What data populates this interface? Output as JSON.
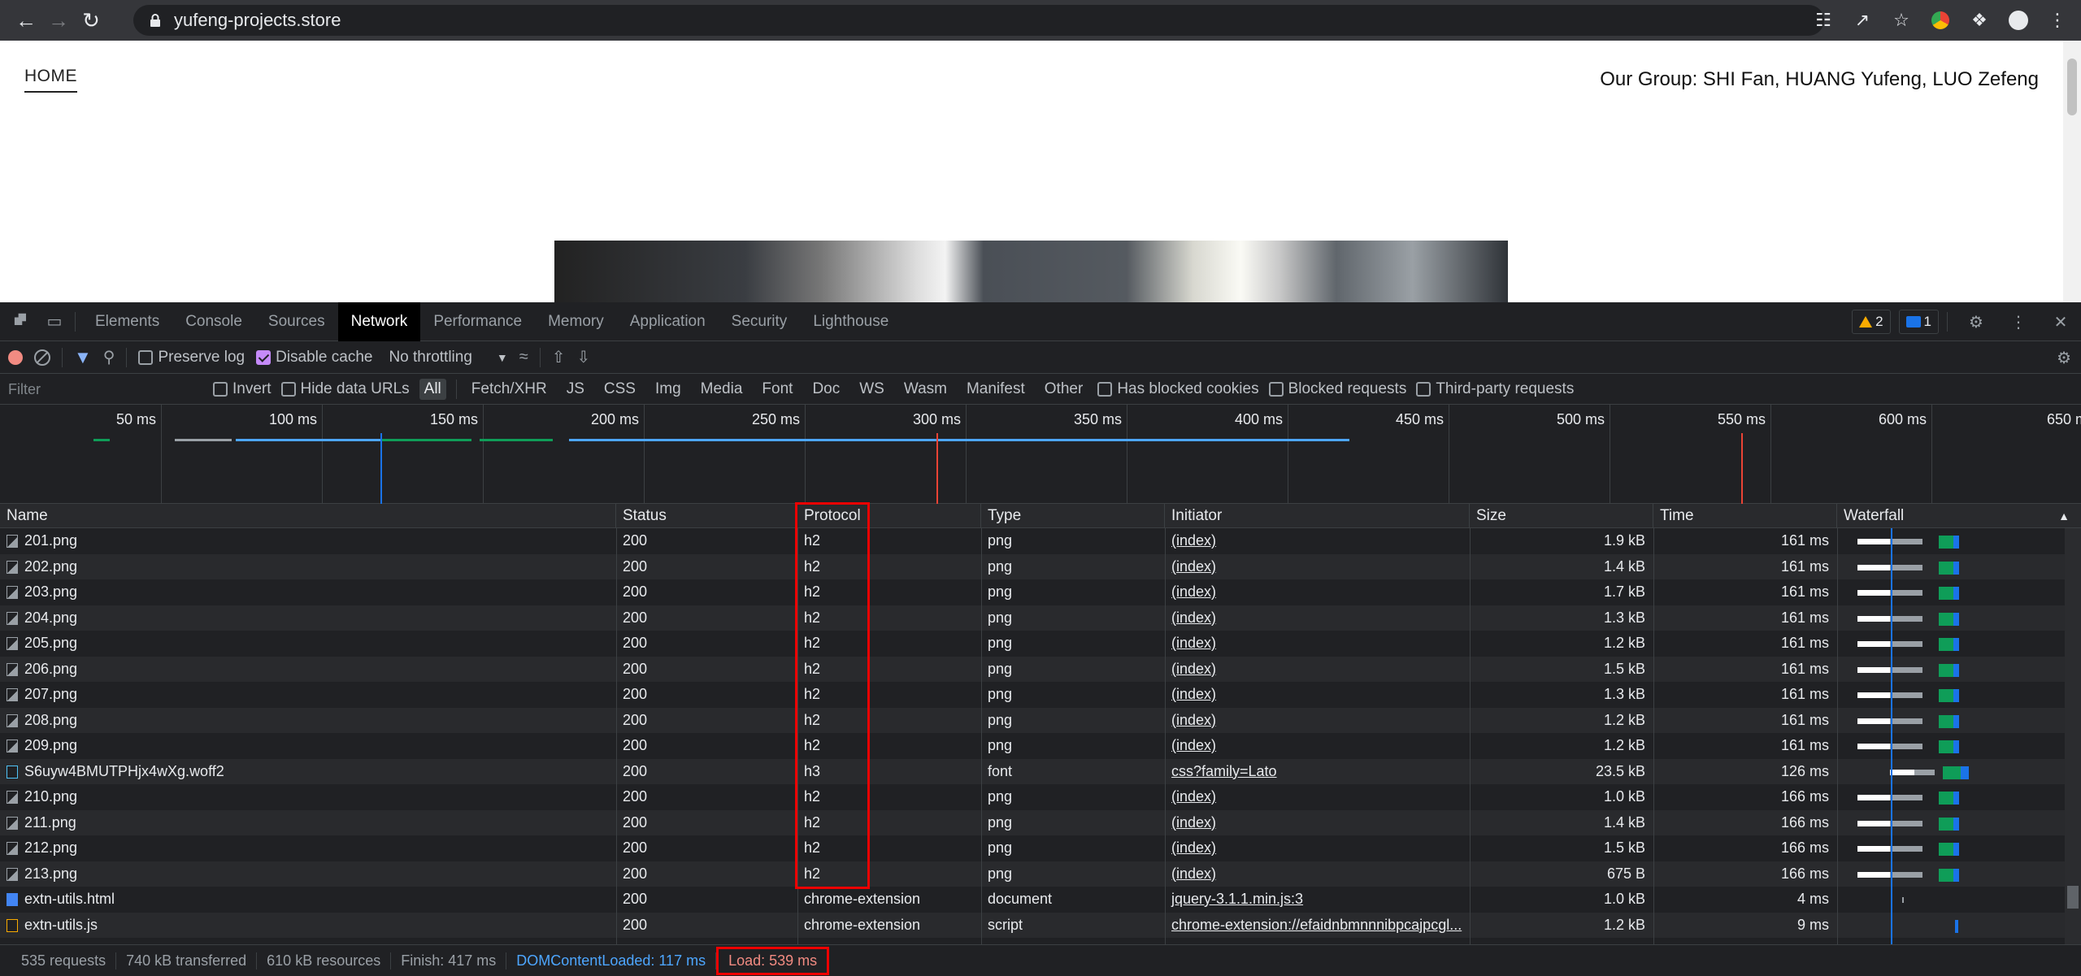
{
  "browser": {
    "url": "yufeng-projects.store",
    "icons": [
      "back-icon",
      "forward-icon",
      "reload-icon",
      "translate-icon",
      "share-icon",
      "star-icon",
      "chrome-ext-icon",
      "extensions-icon",
      "profile-icon",
      "menu-icon"
    ]
  },
  "page": {
    "nav_home": "HOME",
    "group_text": "Our Group: SHI Fan, HUANG Yufeng, LUO Zefeng"
  },
  "devtools": {
    "tabs": [
      "Elements",
      "Console",
      "Sources",
      "Network",
      "Performance",
      "Memory",
      "Application",
      "Security",
      "Lighthouse"
    ],
    "active_tab": "Network",
    "warnings": "2",
    "messages": "1",
    "toolbar": {
      "preserve_log": "Preserve log",
      "disable_cache": "Disable cache",
      "throttling": "No throttling"
    },
    "filter": {
      "placeholder": "Filter",
      "invert": "Invert",
      "hide_data_urls": "Hide data URLs",
      "types": [
        "All",
        "Fetch/XHR",
        "JS",
        "CSS",
        "Img",
        "Media",
        "Font",
        "Doc",
        "WS",
        "Wasm",
        "Manifest",
        "Other"
      ],
      "has_blocked_cookies": "Has blocked cookies",
      "blocked_requests": "Blocked requests",
      "third_party": "Third-party requests"
    },
    "overview_ticks": [
      "50 ms",
      "100 ms",
      "150 ms",
      "200 ms",
      "250 ms",
      "300 ms",
      "350 ms",
      "400 ms",
      "450 ms",
      "500 ms",
      "550 ms",
      "600 ms",
      "650 m"
    ],
    "columns": [
      "Name",
      "Status",
      "Protocol",
      "Type",
      "Initiator",
      "Size",
      "Time",
      "Waterfall"
    ],
    "rows": [
      {
        "name": "201.png",
        "status": "200",
        "protocol": "h2",
        "type": "png",
        "initiator": "(index)",
        "size": "1.9 kB",
        "time": "161 ms",
        "icon": "img"
      },
      {
        "name": "202.png",
        "status": "200",
        "protocol": "h2",
        "type": "png",
        "initiator": "(index)",
        "size": "1.4 kB",
        "time": "161 ms",
        "icon": "img"
      },
      {
        "name": "203.png",
        "status": "200",
        "protocol": "h2",
        "type": "png",
        "initiator": "(index)",
        "size": "1.7 kB",
        "time": "161 ms",
        "icon": "img"
      },
      {
        "name": "204.png",
        "status": "200",
        "protocol": "h2",
        "type": "png",
        "initiator": "(index)",
        "size": "1.3 kB",
        "time": "161 ms",
        "icon": "img"
      },
      {
        "name": "205.png",
        "status": "200",
        "protocol": "h2",
        "type": "png",
        "initiator": "(index)",
        "size": "1.2 kB",
        "time": "161 ms",
        "icon": "img"
      },
      {
        "name": "206.png",
        "status": "200",
        "protocol": "h2",
        "type": "png",
        "initiator": "(index)",
        "size": "1.5 kB",
        "time": "161 ms",
        "icon": "img"
      },
      {
        "name": "207.png",
        "status": "200",
        "protocol": "h2",
        "type": "png",
        "initiator": "(index)",
        "size": "1.3 kB",
        "time": "161 ms",
        "icon": "img"
      },
      {
        "name": "208.png",
        "status": "200",
        "protocol": "h2",
        "type": "png",
        "initiator": "(index)",
        "size": "1.2 kB",
        "time": "161 ms",
        "icon": "img"
      },
      {
        "name": "209.png",
        "status": "200",
        "protocol": "h2",
        "type": "png",
        "initiator": "(index)",
        "size": "1.2 kB",
        "time": "161 ms",
        "icon": "img"
      },
      {
        "name": "S6uyw4BMUTPHjx4wXg.woff2",
        "status": "200",
        "protocol": "h3",
        "type": "font",
        "initiator": "css?family=Lato",
        "size": "23.5 kB",
        "time": "126 ms",
        "icon": "font"
      },
      {
        "name": "210.png",
        "status": "200",
        "protocol": "h2",
        "type": "png",
        "initiator": "(index)",
        "size": "1.0 kB",
        "time": "166 ms",
        "icon": "img"
      },
      {
        "name": "211.png",
        "status": "200",
        "protocol": "h2",
        "type": "png",
        "initiator": "(index)",
        "size": "1.4 kB",
        "time": "166 ms",
        "icon": "img"
      },
      {
        "name": "212.png",
        "status": "200",
        "protocol": "h2",
        "type": "png",
        "initiator": "(index)",
        "size": "1.5 kB",
        "time": "166 ms",
        "icon": "img"
      },
      {
        "name": "213.png",
        "status": "200",
        "protocol": "h2",
        "type": "png",
        "initiator": "(index)",
        "size": "675 B",
        "time": "166 ms",
        "icon": "img"
      },
      {
        "name": "extn-utils.html",
        "status": "200",
        "protocol": "chrome-extension",
        "type": "document",
        "initiator": "jquery-3.1.1.min.js:3",
        "size": "1.0 kB",
        "time": "4 ms",
        "icon": "doc"
      },
      {
        "name": "extn-utils.js",
        "status": "200",
        "protocol": "chrome-extension",
        "type": "script",
        "initiator": "chrome-extension://efaidnbmnnnibpcajpcgl...",
        "size": "1.2 kB",
        "time": "9 ms",
        "icon": "js"
      }
    ],
    "status_bar": {
      "requests": "535 requests",
      "transferred": "740 kB transferred",
      "resources": "610 kB resources",
      "finish": "Finish: 417 ms",
      "dcl": "DOMContentLoaded: 117 ms",
      "load": "Load: 539 ms"
    }
  }
}
